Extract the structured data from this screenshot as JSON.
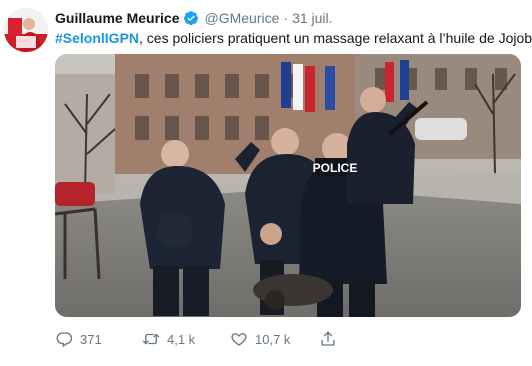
{
  "tweet": {
    "author": {
      "display_name": "Guillaume Meurice",
      "handle": "@GMeurice",
      "verified": true
    },
    "separator": "·",
    "timestamp": "31 juil.",
    "text": {
      "hashtag": "#SelonlIGPN",
      "body": ", ces policiers pratiquent un massage relaxant à l’huile de Jojoba."
    },
    "photo": {
      "vest_label": "POLICE"
    },
    "actions": {
      "reply": {
        "icon": "reply-icon",
        "count": "371"
      },
      "retweet": {
        "icon": "retweet-icon",
        "count": "4,1 k"
      },
      "like": {
        "icon": "heart-icon",
        "count": "10,7 k"
      },
      "share": {
        "icon": "share-icon"
      }
    }
  },
  "colors": {
    "link": "#1b95e0",
    "muted": "#657786",
    "text": "#14171a",
    "verified": "#1da1f2"
  }
}
